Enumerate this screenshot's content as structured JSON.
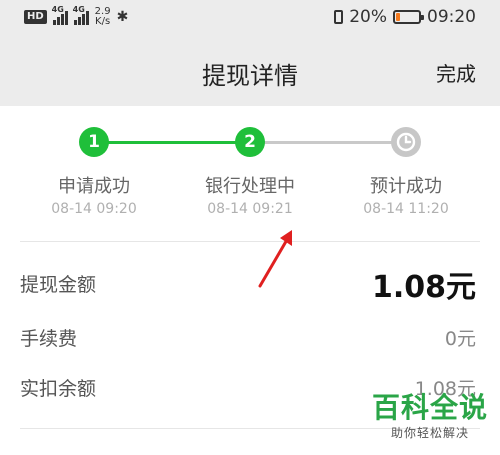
{
  "status_bar": {
    "hd": "HD",
    "signal1_tag": "4G",
    "signal2_tag": "4G",
    "net_speed_value": "2.9",
    "net_speed_unit": "K/s",
    "bluetooth_icon": "bluetooth-icon",
    "battery_text": "20%",
    "battery_level": 0.2,
    "battery_color": "#f47a1f",
    "time": "09:20"
  },
  "header": {
    "title": "提现详情",
    "done_label": "完成"
  },
  "progress": {
    "active_color": "#1fbf3a",
    "inactive_color": "#c7c7c7",
    "steps": [
      {
        "marker": "1",
        "label": "申请成功",
        "time": "08-14 09:20",
        "state": "done"
      },
      {
        "marker": "2",
        "label": "银行处理中",
        "time": "08-14 09:21",
        "state": "current"
      },
      {
        "marker": "clock-icon",
        "label": "预计成功",
        "time": "08-14 11:20",
        "state": "pending"
      }
    ]
  },
  "details": {
    "amount_label": "提现金额",
    "amount_value": "1.08元",
    "fee_label": "手续费",
    "fee_value": "0元",
    "deduct_label": "实扣余额",
    "deduct_value": "1.08元"
  },
  "watermark": {
    "logo_text": "百科全说",
    "sub_text": "助你轻松解决"
  },
  "annotation_color": "#e02020"
}
